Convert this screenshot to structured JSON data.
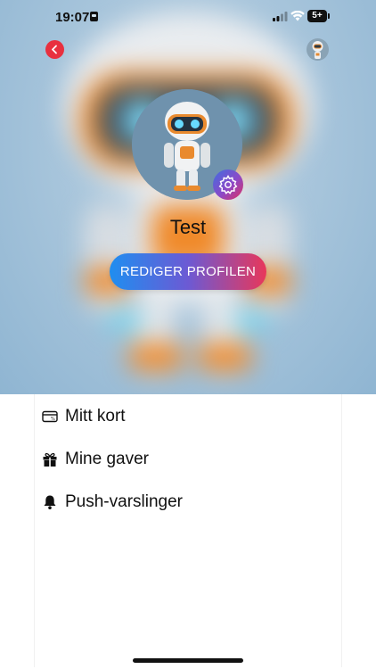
{
  "status_bar": {
    "time": "19:07",
    "battery": "5+"
  },
  "profile": {
    "name": "Test",
    "edit_button_label": "REDIGER PROFILEN"
  },
  "menu": {
    "items": [
      {
        "label": "Mitt kort",
        "icon": "card-icon"
      },
      {
        "label": "Mine gaver",
        "icon": "gift-icon"
      },
      {
        "label": "Push-varslinger",
        "icon": "bell-icon"
      }
    ]
  },
  "colors": {
    "back_button": "#e8303f",
    "gradient_start": "#1f8ef0",
    "gradient_end": "#e8375a"
  }
}
